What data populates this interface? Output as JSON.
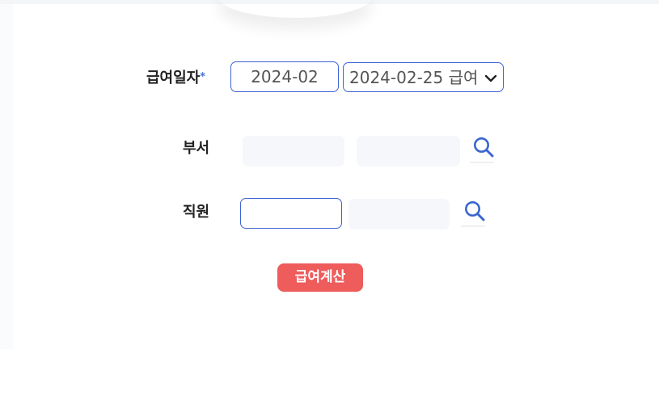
{
  "form": {
    "pay_date": {
      "label": "급여일자",
      "required_mark": "*",
      "month_value": "2024-02",
      "select_value": "2024-02-25 급여"
    },
    "department": {
      "label": "부서",
      "code_value": "",
      "name_value": ""
    },
    "employee": {
      "label": "직원",
      "code_value": "",
      "name_value": ""
    },
    "calc_button_label": "급여계산"
  },
  "icons": {
    "search": "search-icon",
    "dropdown": "chevron-down-icon"
  },
  "colors": {
    "accent_border": "#3e62d6",
    "calc_button": "#ee5c5c",
    "disabled_field": "#f6f7fb",
    "icon_blue": "#3a66cf"
  }
}
